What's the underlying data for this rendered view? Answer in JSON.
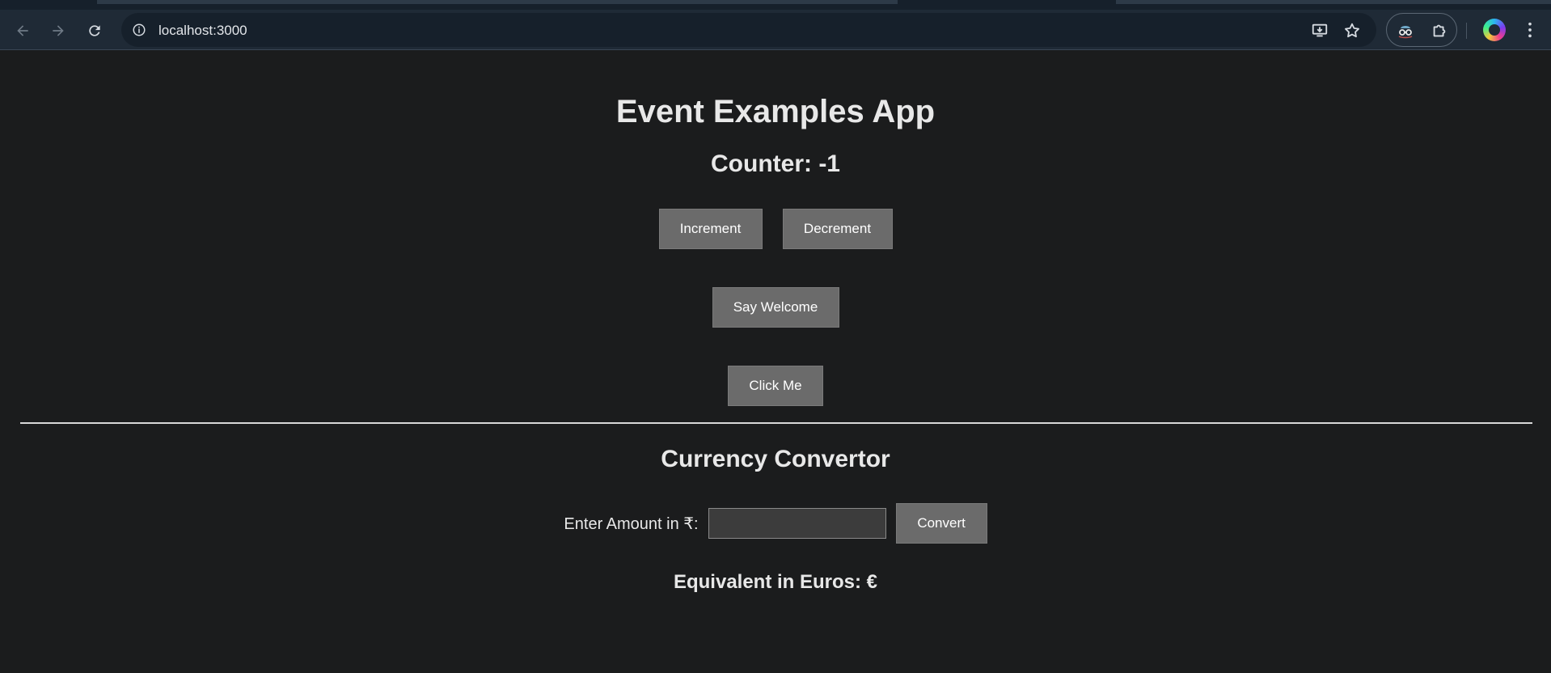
{
  "browser": {
    "url": "localhost:3000",
    "icons": {
      "back": "back-arrow-icon",
      "forward": "forward-arrow-icon",
      "reload": "reload-icon",
      "site_info": "info-icon",
      "install": "install-app-icon",
      "bookmark": "star-icon",
      "extension_1": "incognito-glasses-icon",
      "extensions": "puzzle-icon",
      "profile": "profile-avatar-icon",
      "menu": "kebab-menu-icon"
    }
  },
  "app": {
    "title": "Event Examples App",
    "counter_text": "Counter: -1",
    "buttons": {
      "increment": "Increment",
      "decrement": "Decrement",
      "say_welcome": "Say Welcome",
      "click_me": "Click Me"
    }
  },
  "converter": {
    "title": "Currency Convertor",
    "amount_label": "Enter Amount in ₹:",
    "amount_value": "",
    "convert_label": "Convert",
    "result_text": "Equivalent in Euros: €"
  },
  "colors": {
    "page_bg": "#1b1c1d",
    "button_bg": "#6b6b6b",
    "text": "#e8e8e8",
    "chrome_bg": "#1f2a36"
  }
}
